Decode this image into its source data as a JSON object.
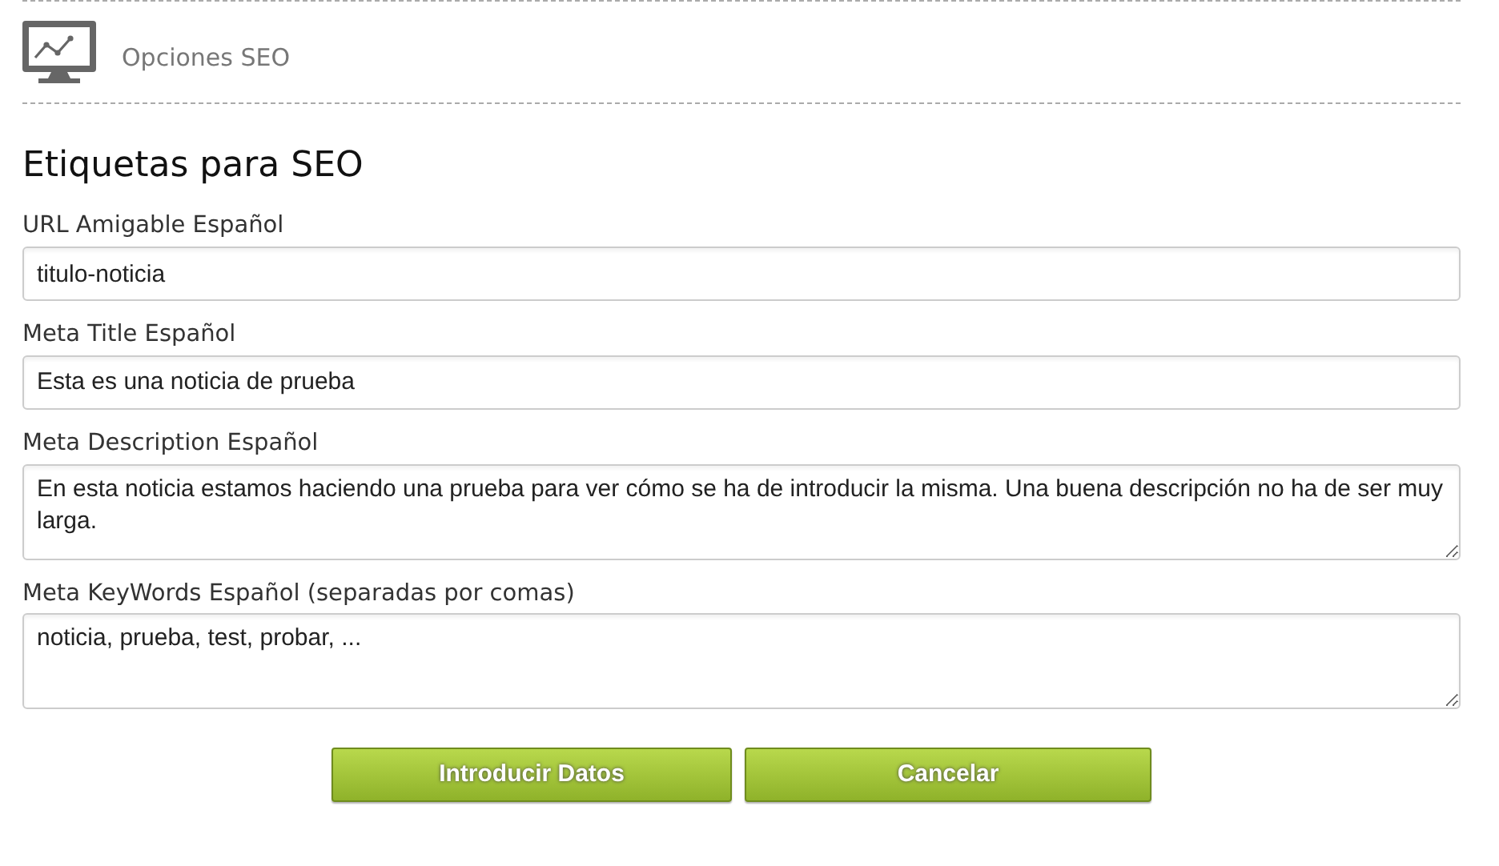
{
  "section_header": {
    "title": "Opciones SEO"
  },
  "heading": "Etiquetas para SEO",
  "fields": [
    {
      "label": "URL Amigable Español",
      "kind": "input",
      "value": "titulo-noticia"
    },
    {
      "label": "Meta Title Español",
      "kind": "input",
      "value": "Esta es una noticia de prueba"
    },
    {
      "label": "Meta Description Español",
      "kind": "textarea",
      "value": "En esta noticia estamos haciendo una prueba para ver cómo se ha de introducir la misma. Una buena descripción no ha de ser muy larga."
    },
    {
      "label": "Meta KeyWords Español (separadas por comas)",
      "kind": "textarea",
      "value": "noticia, prueba, test, probar, ..."
    }
  ],
  "buttons": [
    "Introducir Datos",
    "Cancelar"
  ]
}
